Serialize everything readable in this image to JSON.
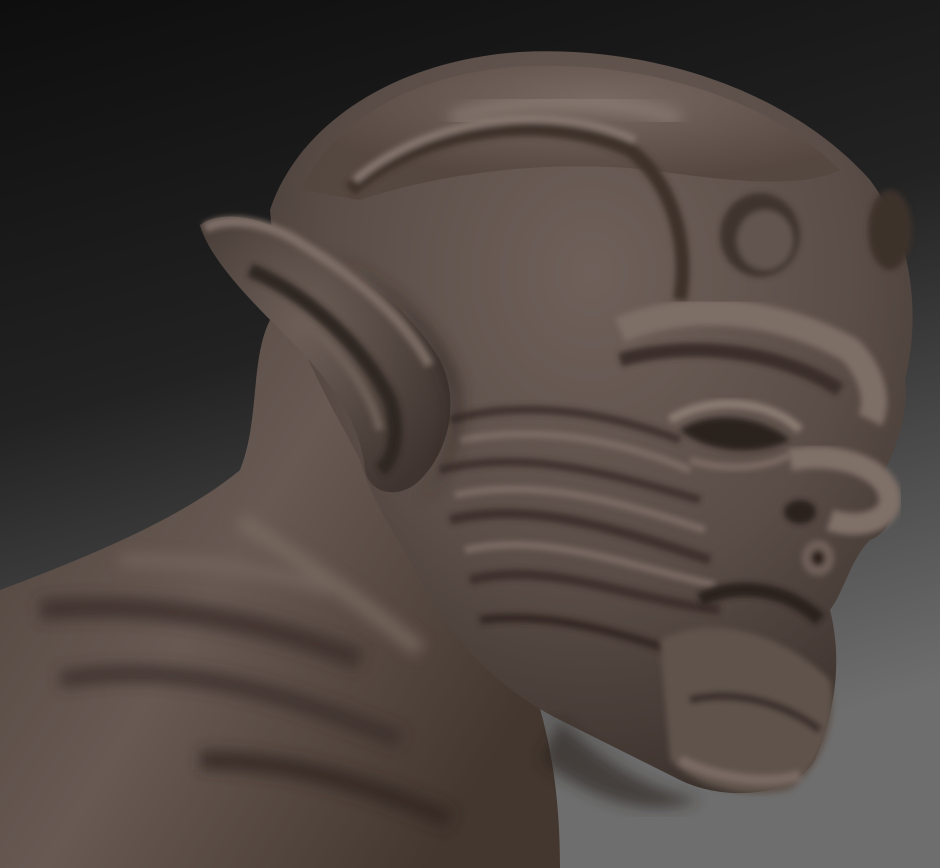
{
  "scene": {
    "subject": "sculpted-creature-head",
    "material_color": "#5e514b",
    "material_highlight": "#7f7069",
    "material_shadow": "#2e2622",
    "background_top": "#121212",
    "background_bottom": "#6a6a6a"
  }
}
